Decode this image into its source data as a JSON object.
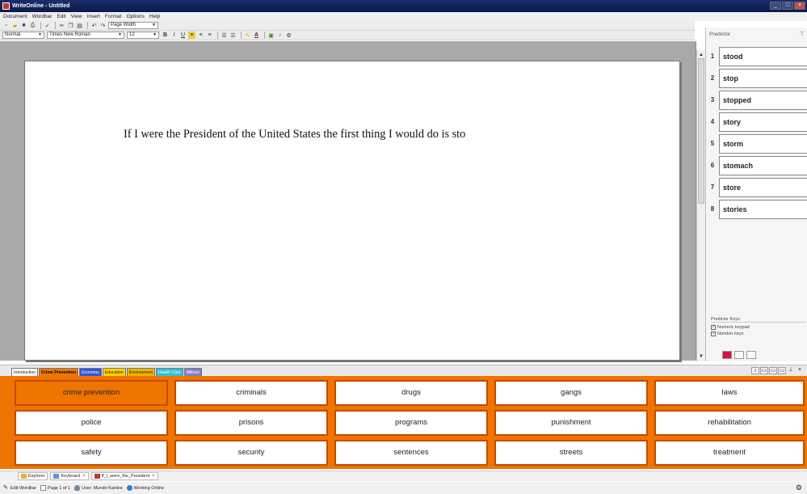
{
  "window": {
    "title": "WriteOnline - Untitled"
  },
  "menu": [
    "Document",
    "Wordbar",
    "Edit",
    "View",
    "Insert",
    "Format",
    "Options",
    "Help"
  ],
  "toolbar": {
    "zoom": "Page Width",
    "style": "Normal",
    "font": "Times New Roman",
    "size": "12",
    "bold": "B",
    "italic": "I",
    "underline": "U",
    "text_color": "A"
  },
  "document": {
    "text": "If I were the President of the United States the first thing I would do is sto"
  },
  "predictor": {
    "title": "Predictor",
    "items": [
      {
        "num": "1",
        "word": "stood"
      },
      {
        "num": "2",
        "word": "stop"
      },
      {
        "num": "3",
        "word": "stopped"
      },
      {
        "num": "4",
        "word": "story"
      },
      {
        "num": "5",
        "word": "storm"
      },
      {
        "num": "6",
        "word": "stomach"
      },
      {
        "num": "7",
        "word": "store"
      },
      {
        "num": "8",
        "word": "stories"
      }
    ],
    "keys_title": "Predictor Keys",
    "options": [
      {
        "label": "Numeric keypad",
        "checked": true
      },
      {
        "label": "Number keys",
        "checked": true
      }
    ]
  },
  "wordbar": {
    "tabs": [
      {
        "label": "Introduction",
        "cls": "intro"
      },
      {
        "label": "Crime Prevention",
        "cls": "crime"
      },
      {
        "label": "Economy",
        "cls": "econ"
      },
      {
        "label": "Education",
        "cls": "edu"
      },
      {
        "label": "Environment",
        "cls": "env"
      },
      {
        "label": "Health Care",
        "cls": "health"
      },
      {
        "label": "Military",
        "cls": "mil"
      }
    ],
    "words": [
      [
        "crime prevention",
        "criminals",
        "drugs",
        "gangs",
        "laws"
      ],
      [
        "police",
        "prisons",
        "programs",
        "punishment",
        "rehabilitation"
      ],
      [
        "safety",
        "security",
        "sentences",
        "streets",
        "treatment"
      ]
    ],
    "accent": "#f07400"
  },
  "doc_tabs": [
    {
      "label": "Explorer",
      "close": ""
    },
    {
      "label": "Keyboard",
      "close": "×"
    },
    {
      "label": "If_I_were_the_President",
      "close": "×"
    }
  ],
  "status": {
    "edit_wordbar": "Edit Wordbar",
    "page": "Page 1 of 1",
    "user": "User: Munde Kardos",
    "online": "Working Online"
  }
}
